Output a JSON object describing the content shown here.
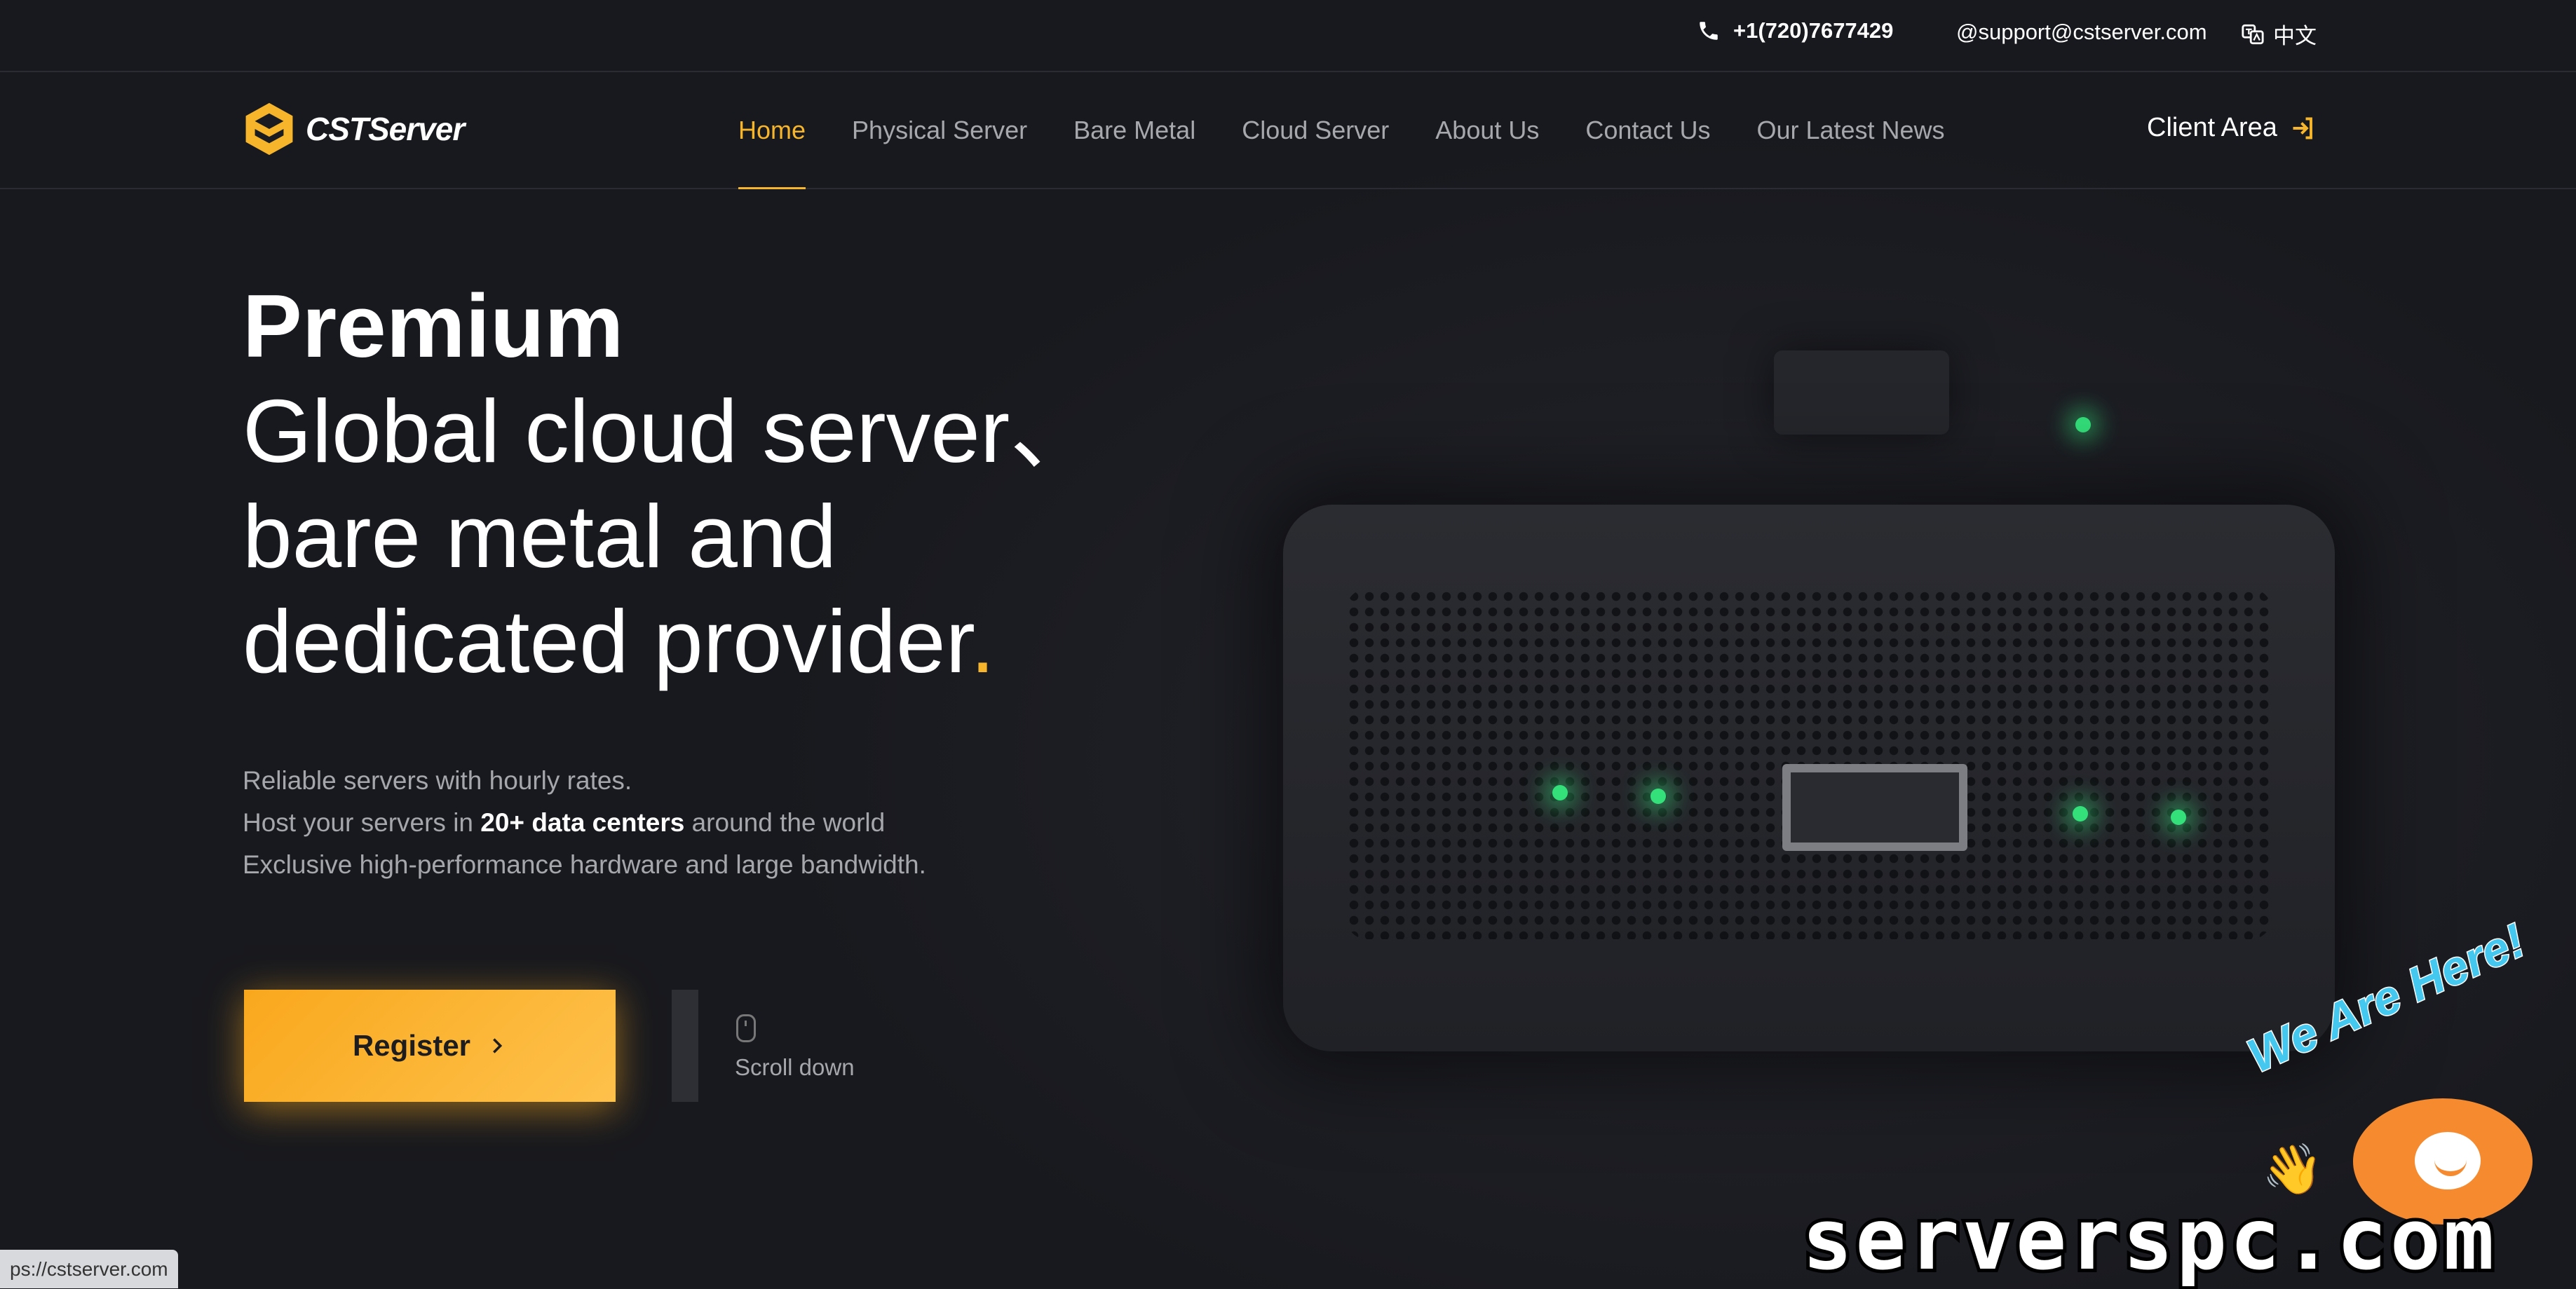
{
  "topbar": {
    "phone": "+1(720)7677429",
    "email": "@support@cstserver.com",
    "language": "中文",
    "phone_icon": "phone-icon",
    "language_icon": "translate-icon"
  },
  "header": {
    "logo_text": "CSTServer",
    "nav": [
      {
        "label": "Home",
        "active": true
      },
      {
        "label": "Physical Server",
        "active": false
      },
      {
        "label": "Bare Metal",
        "active": false
      },
      {
        "label": "Cloud Server",
        "active": false
      },
      {
        "label": "About Us",
        "active": false
      },
      {
        "label": "Contact Us",
        "active": false
      },
      {
        "label": "Our Latest News",
        "active": false
      }
    ],
    "client_area": "Client Area",
    "client_area_icon": "login-arrow-icon"
  },
  "hero": {
    "title_bold": "Premium",
    "title_line1": "Global cloud server、",
    "title_line2": "bare metal and",
    "title_line3": "dedicated provider",
    "title_dot": ".",
    "desc_line1": "Reliable servers with hourly rates.",
    "desc_line2_pre": "Host your servers in ",
    "desc_line2_bold": "20+ data centers",
    "desc_line2_post": " around the world",
    "desc_line3": "Exclusive high-performance hardware and large bandwidth.",
    "register_label": "Register",
    "scroll_label": "Scroll down"
  },
  "chat": {
    "tagline": "We Are Here!",
    "wave": "👋"
  },
  "watermark": "serverspc.com",
  "status_bar": "ps://cstserver.com",
  "colors": {
    "accent": "#f6b52b",
    "background": "#1b1c22",
    "led": "#33e07a",
    "chat": "#f58a2f"
  }
}
